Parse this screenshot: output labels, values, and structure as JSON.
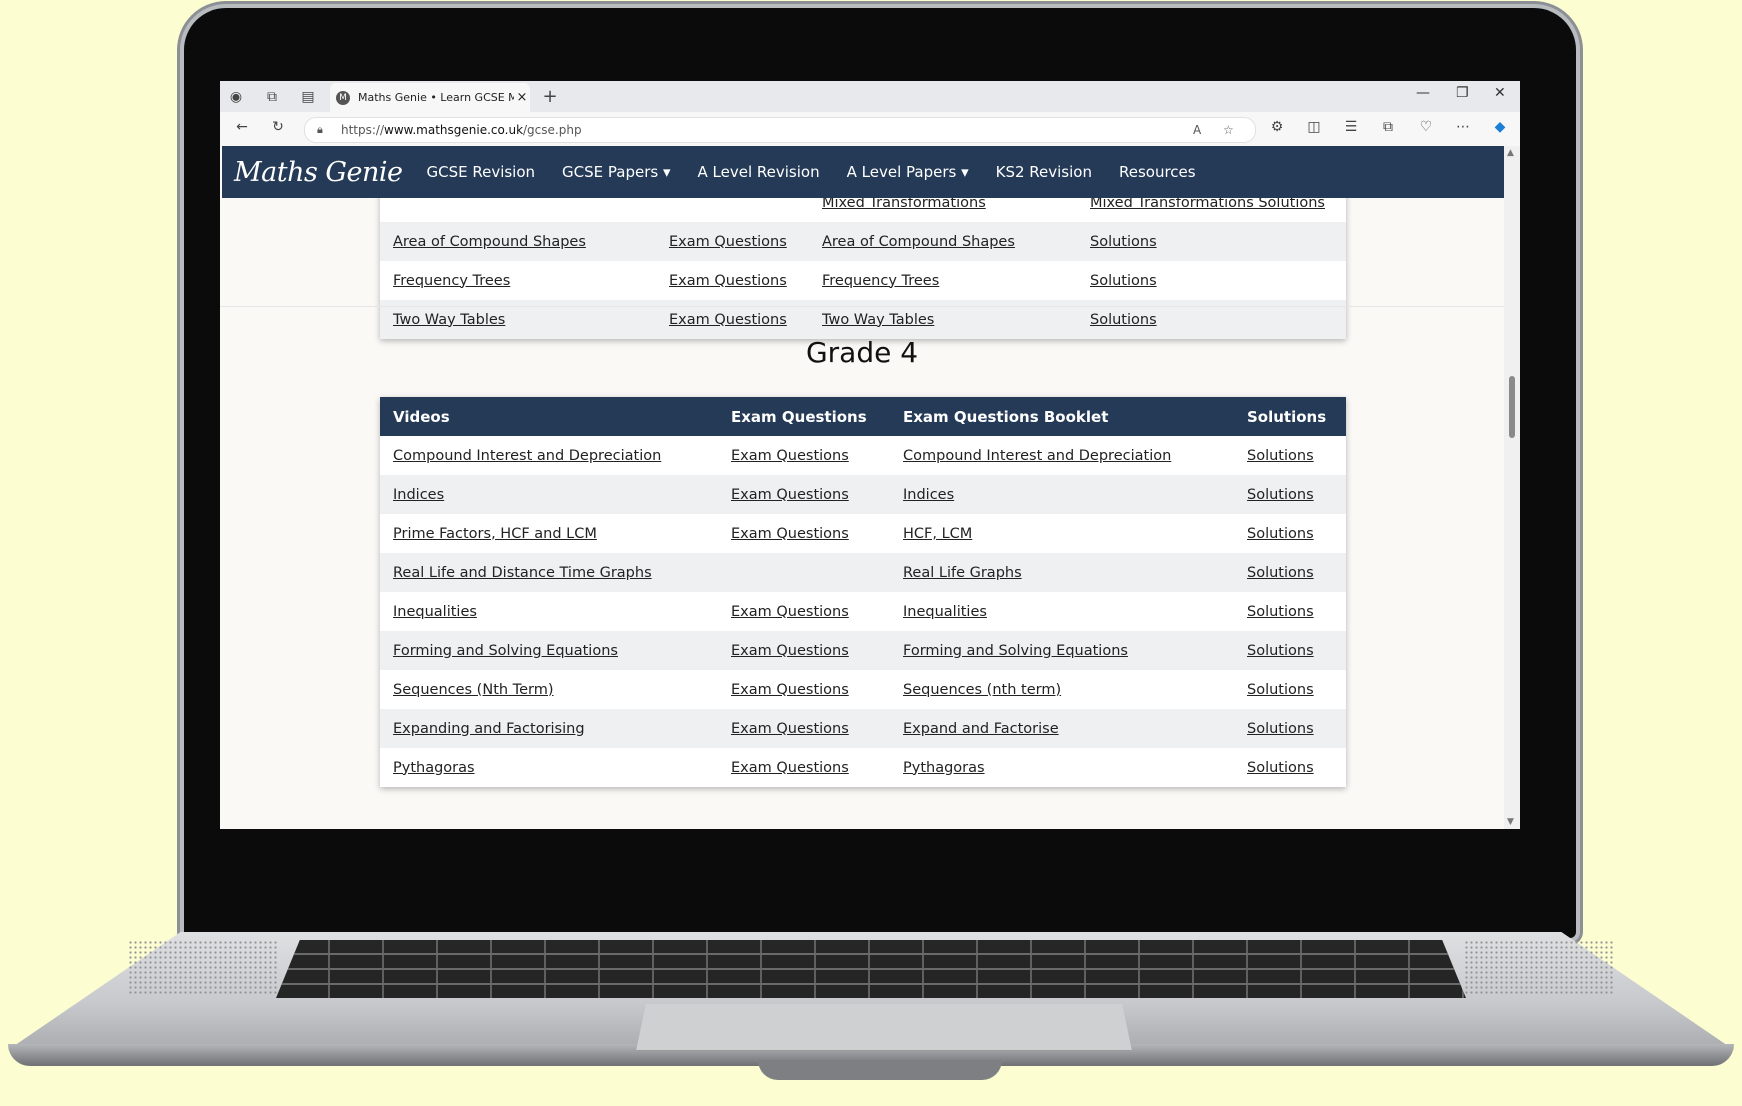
{
  "browser": {
    "tab_title": "Maths Genie • Learn GCSE Maths",
    "favicon": "M",
    "new_tab": "+",
    "close": "×",
    "url_prefix": "https://",
    "url_domain": "www.mathsgenie.co.uk",
    "url_path": "/gcse.php",
    "read_aloud": "A",
    "min": "—",
    "restore": "❐",
    "win_close": "✕"
  },
  "site": {
    "logo": "Maths Genie",
    "nav": [
      "GCSE Revision",
      "GCSE Papers ▾",
      "A Level Revision",
      "A Level Papers ▾",
      "KS2 Revision",
      "Resources"
    ]
  },
  "grade3_rows": [
    {
      "video": "",
      "exam": "",
      "booklet": "Mixed Transformations",
      "solutions": "Mixed Transformations Solutions"
    },
    {
      "video": "Area of Compound Shapes",
      "exam": "Exam Questions",
      "booklet": "Area of Compound Shapes",
      "solutions": "Solutions"
    },
    {
      "video": "Frequency Trees",
      "exam": "Exam Questions",
      "booklet": "Frequency Trees",
      "solutions": "Solutions"
    },
    {
      "video": "Two Way Tables",
      "exam": "Exam Questions",
      "booklet": "Two Way Tables",
      "solutions": "Solutions"
    }
  ],
  "grade4": {
    "title": "Grade 4",
    "headers": [
      "Videos",
      "Exam Questions",
      "Exam Questions Booklet",
      "Solutions"
    ],
    "rows": [
      {
        "video": "Compound Interest and Depreciation",
        "exam": "Exam Questions",
        "booklet": "Compound Interest and Depreciation",
        "solutions": "Solutions"
      },
      {
        "video": "Indices",
        "exam": "Exam Questions",
        "booklet": "Indices",
        "solutions": "Solutions"
      },
      {
        "video": "Prime Factors, HCF and LCM",
        "exam": "Exam Questions",
        "booklet": "HCF, LCM",
        "solutions": "Solutions"
      },
      {
        "video": "Real Life and Distance Time Graphs",
        "exam": "",
        "booklet": "Real Life Graphs",
        "solutions": "Solutions"
      },
      {
        "video": "Inequalities",
        "exam": "Exam Questions",
        "booklet": "Inequalities",
        "solutions": "Solutions"
      },
      {
        "video": "Forming and Solving Equations",
        "exam": "Exam Questions",
        "booklet": "Forming and Solving Equations",
        "solutions": "Solutions"
      },
      {
        "video": "Sequences (Nth Term)",
        "exam": "Exam Questions",
        "booklet": "Sequences (nth term)",
        "solutions": "Solutions"
      },
      {
        "video": "Expanding and Factorising",
        "exam": "Exam Questions",
        "booklet": "Expand and Factorise",
        "solutions": "Solutions"
      },
      {
        "video": "Pythagoras",
        "exam": "Exam Questions",
        "booklet": "Pythagoras",
        "solutions": "Solutions"
      }
    ]
  }
}
